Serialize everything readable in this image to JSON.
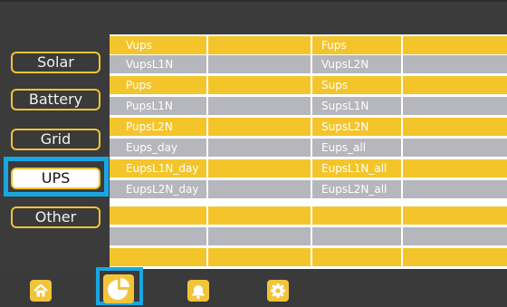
{
  "menu": {
    "items": [
      {
        "label": "Solar"
      },
      {
        "label": "Battery"
      },
      {
        "label": "Grid"
      },
      {
        "label": "UPS"
      },
      {
        "label": "Other"
      }
    ],
    "active": "UPS"
  },
  "table": {
    "rows": [
      {
        "left": "Vups",
        "right": "Fups",
        "color": "yellow"
      },
      {
        "left": "VupsL1N",
        "right": "VupsL2N",
        "color": "gray"
      },
      {
        "left": "Pups",
        "right": "Sups",
        "color": "yellow"
      },
      {
        "left": "PupsL1N",
        "right": "SupsL1N",
        "color": "gray"
      },
      {
        "left": "PupsL2N",
        "right": "SupsL2N",
        "color": "yellow"
      },
      {
        "left": "Eups_day",
        "right": "Eups_all",
        "color": "gray"
      },
      {
        "left": "EupsL1N_day",
        "right": "EupsL1N_all",
        "color": "yellow"
      },
      {
        "left": "EupsL2N_day",
        "right": "EupsL2N_all",
        "color": "gray"
      },
      {
        "left": "",
        "right": "",
        "color": "yellow"
      },
      {
        "left": "",
        "right": "",
        "color": "gray"
      },
      {
        "left": "",
        "right": "",
        "color": "yellow"
      }
    ]
  },
  "nav": {
    "items": [
      {
        "icon": "home-icon"
      },
      {
        "icon": "pie-chart-icon",
        "active": true
      },
      {
        "icon": "bell-icon"
      },
      {
        "icon": "settings-icon"
      }
    ]
  },
  "colors": {
    "accent": "#f4c52b",
    "gray_row": "#b6b6bd",
    "highlight": "#1aa6e0",
    "background": "#3b3b3b"
  }
}
